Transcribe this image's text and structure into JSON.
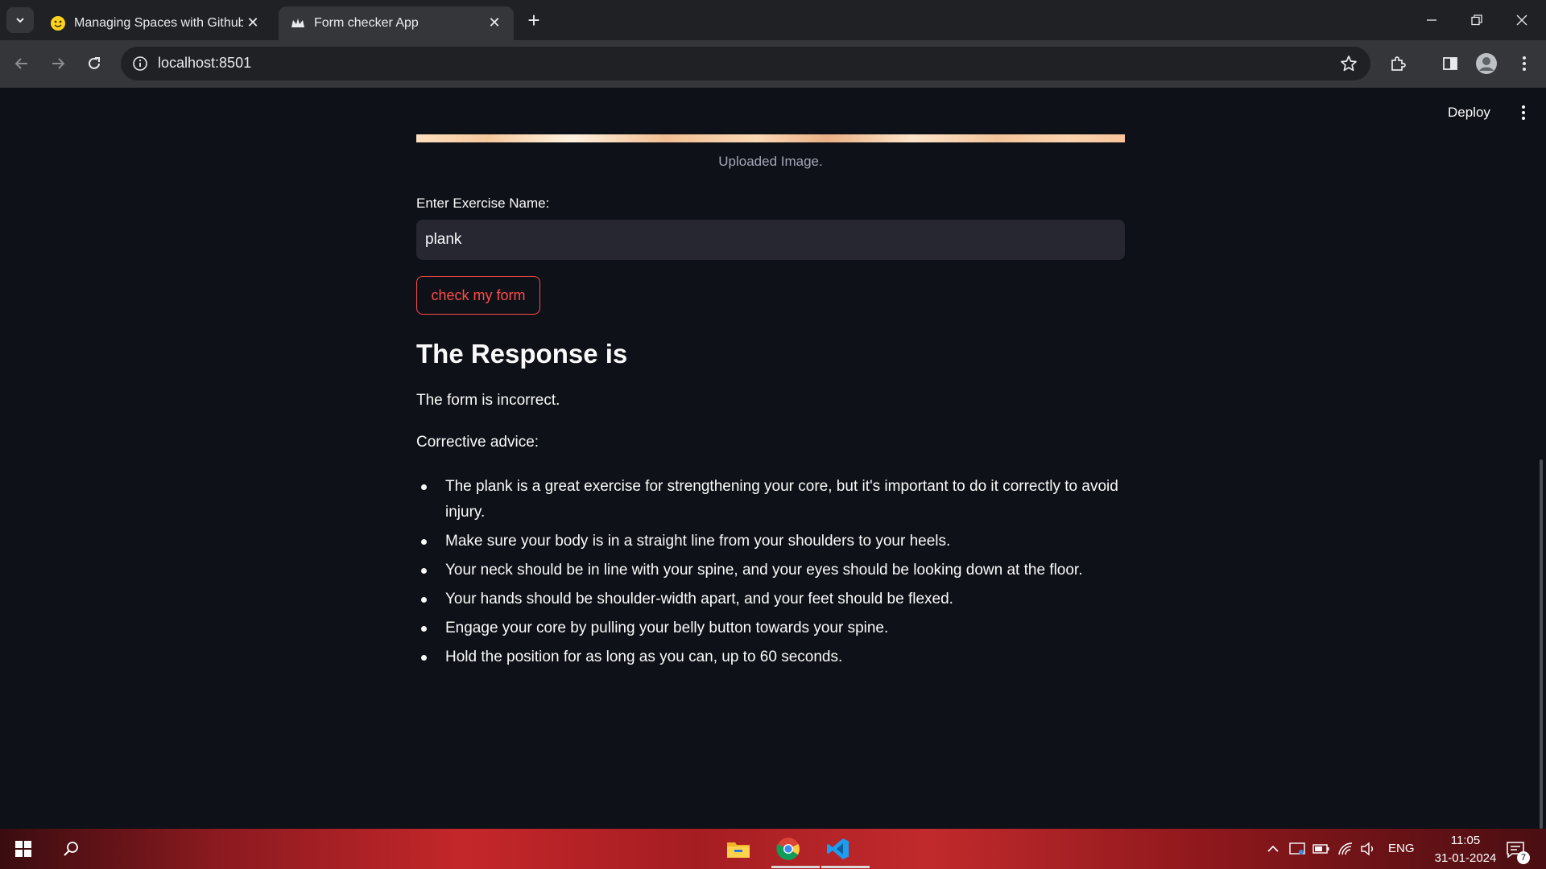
{
  "browser": {
    "tabs": [
      {
        "title": "Managing Spaces with Github A",
        "favicon": "hugging-face-icon",
        "active": false
      },
      {
        "title": "Form checker App",
        "favicon": "streamlit-crown-icon",
        "active": true
      }
    ],
    "url": "localhost:8501"
  },
  "app": {
    "deploy_label": "Deploy",
    "image_caption": "Uploaded Image.",
    "exercise_label": "Enter Exercise Name:",
    "exercise_value": "plank",
    "check_button": "check my form",
    "response_heading": "The Response is",
    "verdict": "The form is incorrect.",
    "advice_label": "Corrective advice:",
    "advice": [
      "The plank is a great exercise for strengthening your core, but it's important to do it correctly to avoid injury.",
      "Make sure your body is in a straight line from your shoulders to your heels.",
      "Your neck should be in line with your spine, and your eyes should be looking down at the floor.",
      "Your hands should be shoulder-width apart, and your feet should be flexed.",
      "Engage your core by pulling your belly button towards your spine.",
      "Hold the position for as long as you can, up to 60 seconds."
    ],
    "accent_color": "#ff4b4b"
  },
  "taskbar": {
    "apps": [
      "file-explorer-icon",
      "chrome-icon",
      "vscode-icon"
    ],
    "language": "ENG",
    "time": "11:05",
    "date": "31-01-2024",
    "notification_count": "7"
  }
}
